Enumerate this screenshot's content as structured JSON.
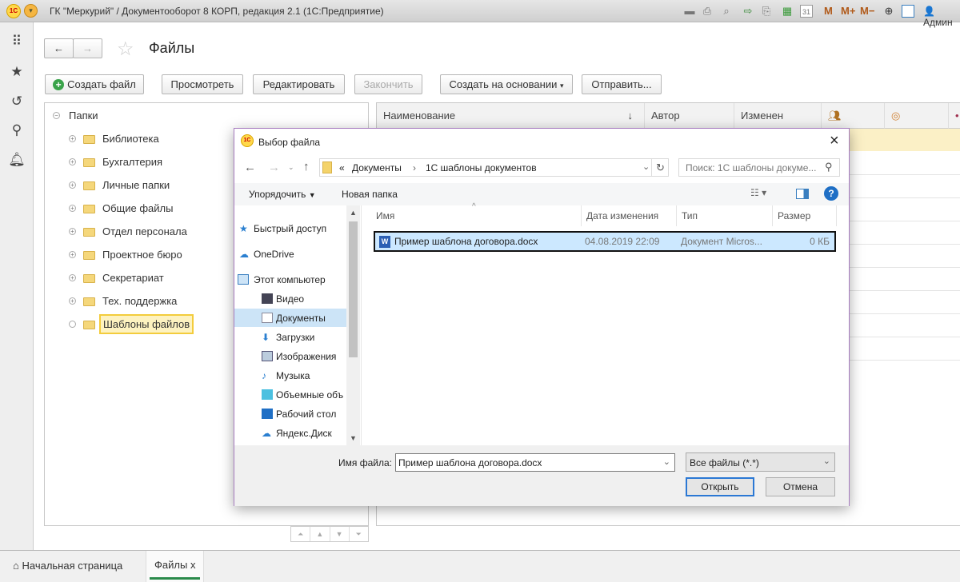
{
  "window": {
    "title": "ГК \"Меркурий\" / Документооборот 8 КОРП, редакция 2.1  (1С:Предприятие)",
    "user": "Админ",
    "toolbar_icons": [
      "save-icon",
      "print-icon",
      "preview-icon",
      "send-icon",
      "fax-icon",
      "calculator-icon",
      "calendar-icon",
      "zoom-icon",
      "panel-icon"
    ],
    "m_buttons": [
      "M",
      "M+",
      "M−"
    ],
    "calendar_day": "31"
  },
  "page": {
    "title": "Файлы"
  },
  "toolbar": {
    "create_file": "Создать файл",
    "view": "Просмотреть",
    "edit": "Редактировать",
    "finish": "Закончить",
    "create_based": "Создать на основании",
    "send": "Отправить..."
  },
  "tree": {
    "root": "Папки",
    "items": [
      "Библиотека",
      "Бухгалтерия",
      "Личные папки",
      "Общие файлы",
      "Отдел персонала",
      "Проектное бюро",
      "Секретариат",
      "Тех. поддержка",
      "Шаблоны файлов"
    ],
    "selected": "Шаблоны файлов"
  },
  "grid": {
    "columns": [
      "Наименование",
      "Автор",
      "Изменен"
    ],
    "sort_indicator": "↓"
  },
  "tabs": [
    {
      "label": "Начальная страница"
    },
    {
      "label": "Файлы",
      "close": "x"
    }
  ],
  "dialog": {
    "title": "Выбор файла",
    "path": [
      "Документы",
      "1С шаблоны документов"
    ],
    "path_prefix": "«",
    "search_placeholder": "Поиск: 1С шаблоны докуме...",
    "organize": "Упорядочить",
    "new_folder": "Новая папка",
    "nav": [
      "Быстрый доступ",
      "OneDrive",
      "Этот компьютер",
      "Видео",
      "Документы",
      "Загрузки",
      "Изображения",
      "Музыка",
      "Объемные объ",
      "Рабочий стол",
      "Яндекс.Диск"
    ],
    "nav_selected": "Документы",
    "columns": [
      "Имя",
      "Дата изменения",
      "Тип",
      "Размер"
    ],
    "files": [
      {
        "name": "Пример шаблона договора.docx",
        "date": "04.08.2019 22:09",
        "type": "Документ Micros...",
        "size": "0 КБ"
      }
    ],
    "filename_label": "Имя файла:",
    "filename": "Пример шаблона договора.docx",
    "filter": "Все файлы (*.*)",
    "open": "Открыть",
    "cancel": "Отмена"
  }
}
